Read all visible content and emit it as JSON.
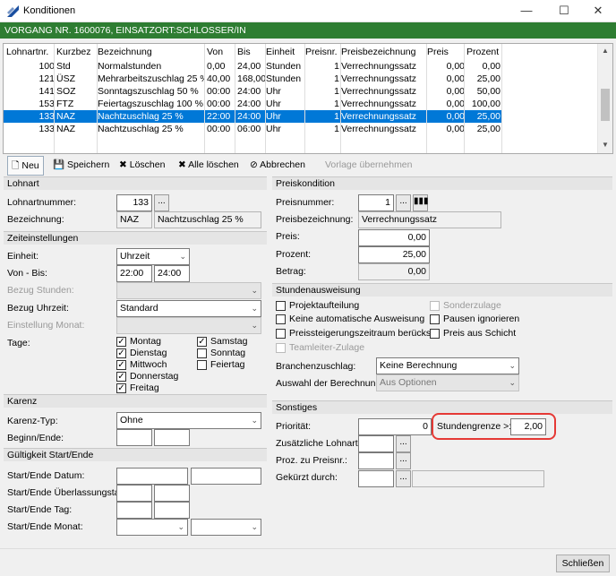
{
  "window": {
    "title": "Konditionen",
    "min": "—",
    "max": "☐",
    "close": "✕"
  },
  "header_bar": "VORGANG NR. 1600076, EINSATZORT:SCHLOSSER/IN",
  "grid": {
    "columns": [
      "Lohnartnr.",
      "Kurzbez.",
      "Bezeichnung",
      "Von",
      "Bis",
      "Einheit",
      "Preisnr.",
      "Preisbezeichnung",
      "Preis",
      "Prozent"
    ],
    "rows": [
      [
        "100",
        "Std",
        "Normalstunden",
        "0,00",
        "24,00",
        "Stunden",
        "1",
        "Verrechnungssatz",
        "0,00",
        "0,00"
      ],
      [
        "121",
        "ÜSZ",
        "Mehrarbeitszuschlag 25 %",
        "40,00",
        "168,00",
        "Stunden",
        "1",
        "Verrechnungssatz",
        "0,00",
        "25,00"
      ],
      [
        "141",
        "SOZ",
        "Sonntagszuschlag 50 %",
        "00:00",
        "24:00",
        "Uhr",
        "1",
        "Verrechnungssatz",
        "0,00",
        "50,00"
      ],
      [
        "153",
        "FTZ",
        "Feiertagszuschlag 100 %",
        "00:00",
        "24:00",
        "Uhr",
        "1",
        "Verrechnungssatz",
        "0,00",
        "100,00"
      ],
      [
        "133",
        "NAZ",
        "Nachtzuschlag 25 %",
        "22:00",
        "24:00",
        "Uhr",
        "1",
        "Verrechnungssatz",
        "0,00",
        "25,00"
      ],
      [
        "133",
        "NAZ",
        "Nachtzuschlag 25 %",
        "00:00",
        "06:00",
        "Uhr",
        "1",
        "Verrechnungssatz",
        "0,00",
        "25,00"
      ]
    ],
    "selected_row": 4
  },
  "toolbar": {
    "new": "Neu",
    "save": "Speichern",
    "delete": "Löschen",
    "delete_all": "Alle löschen",
    "cancel": "Abbrechen",
    "apply_template": "Vorlage übernehmen"
  },
  "lohnart": {
    "title": "Lohnart",
    "number_label": "Lohnartnummer:",
    "number": "133",
    "desc_label": "Bezeichnung:",
    "short": "NAZ",
    "desc": "Nachtzuschlag 25 %"
  },
  "zeit": {
    "title": "Zeiteinstellungen",
    "unit_label": "Einheit:",
    "unit": "Uhrzeit",
    "from_to_label": "Von - Bis:",
    "from": "22:00",
    "to": "24:00",
    "ref_hours_label": "Bezug Stunden:",
    "ref_time_label": "Bezug Uhrzeit:",
    "ref_time": "Standard",
    "month_label": "Einstellung Monat:",
    "days_label": "Tage:",
    "days": {
      "mon": "Montag",
      "tue": "Dienstag",
      "wed": "Mittwoch",
      "thu": "Donnerstag",
      "fri": "Freitag",
      "sat": "Samstag",
      "sun": "Sonntag",
      "hol": "Feiertag"
    }
  },
  "karenz": {
    "title": "Karenz",
    "type_label": "Karenz-Typ:",
    "type": "Ohne",
    "begin_end_label": "Beginn/Ende:"
  },
  "gueltig": {
    "title": "Gültigkeit Start/Ende",
    "date_label": "Start/Ende Datum:",
    "overlap_label": "Start/Ende Überlassungstag:",
    "day_label": "Start/Ende Tag:",
    "month_label": "Start/Ende Monat:"
  },
  "preis": {
    "title": "Preiskondition",
    "number_label": "Preisnummer:",
    "number": "1",
    "desc_label": "Preisbezeichnung:",
    "desc": "Verrechnungssatz",
    "price_label": "Preis:",
    "price": "0,00",
    "percent_label": "Prozent:",
    "percent": "25,00",
    "amount_label": "Betrag:",
    "amount": "0,00"
  },
  "stunden": {
    "title": "Stundenausweisung",
    "project": "Projektaufteilung",
    "special": "Sonderzulage",
    "no_auto": "Keine automatische Ausweisung",
    "ignore_breaks": "Pausen ignorieren",
    "price_increase": "Preissteigerungszeitraum berücks.",
    "price_shift": "Preis aus Schicht",
    "team_lead": "Teamleiter-Zulage",
    "branch_label": "Branchenzuschlag:",
    "branch": "Keine Berechnung",
    "calc_label": "Auswahl der Berechnung:",
    "calc": "Aus Optionen"
  },
  "sonstiges": {
    "title": "Sonstiges",
    "priority_label": "Priorität:",
    "priority": "0",
    "hour_limit_label": "Stundengrenze >:",
    "hour_limit": "2,00",
    "extra_label": "Zusätzliche Lohnart:",
    "proz_label": "Proz. zu Preisnr.:",
    "shortened_label": "Gekürzt durch:"
  },
  "close_button": "Schließen"
}
